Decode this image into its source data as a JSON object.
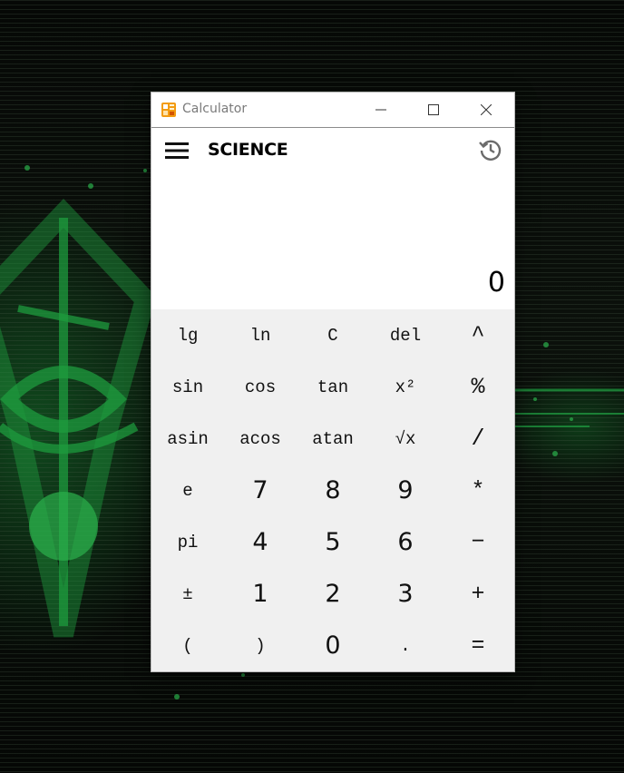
{
  "window": {
    "title": "Calculator",
    "icon": "calculator-app-icon",
    "controls": [
      "minimize-icon",
      "maximize-icon",
      "close-icon"
    ]
  },
  "appbar": {
    "mode": "SCIENCE",
    "menu_icon": "hamburger-menu-icon",
    "history_icon": "history-icon"
  },
  "display": {
    "value": "0"
  },
  "keypad": {
    "rows": [
      [
        "lg",
        "ln",
        "C",
        "del",
        "^"
      ],
      [
        "sin",
        "cos",
        "tan",
        "x²",
        "%"
      ],
      [
        "asin",
        "acos",
        "atan",
        "√x",
        "/"
      ],
      [
        "e",
        "7",
        "8",
        "9",
        "*"
      ],
      [
        "pi",
        "4",
        "5",
        "6",
        "−"
      ],
      [
        "±",
        "1",
        "2",
        "3",
        "+"
      ],
      [
        "(",
        ")",
        "0",
        ".",
        "="
      ]
    ]
  },
  "colors": {
    "keypad_bg": "#f0f0f0",
    "window_bg": "#ffffff",
    "title_text": "#7a7a7a",
    "wallpaper_accent": "#1f9a3c"
  }
}
